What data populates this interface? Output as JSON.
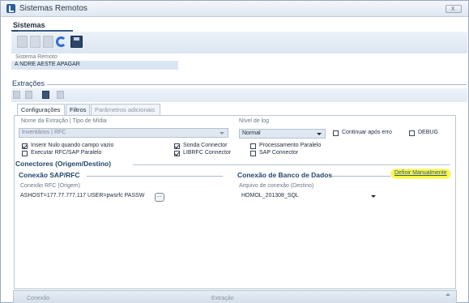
{
  "window": {
    "title": "Sistemas Remotos",
    "doc_tab": "Sistemas Remotos"
  },
  "toolbar": {
    "icons": [
      "new-icon",
      "edit-icon",
      "delete-icon",
      "refresh-icon",
      "save-icon"
    ]
  },
  "sistema": {
    "label": "Sistema Remoto",
    "value": "A NDRE AESTE APAGAR"
  },
  "extracoes": {
    "title": "Extrações",
    "toolbar_icons": [
      "add-icon",
      "edit-icon",
      "save-icon",
      "delete-icon"
    ]
  },
  "tabs": [
    {
      "label": "Configurações",
      "state": "active"
    },
    {
      "label": "Filtros",
      "state": "normal"
    },
    {
      "label": "Parâmetros adicionais",
      "state": "disabled"
    }
  ],
  "config": {
    "nome_label": "Nome da Extração | Tipo de Mídia",
    "nome_value": "Inventários | RFC",
    "nivel_label": "Nível de log",
    "nivel_value": "Normal",
    "continuar_label": "Continuar após erro",
    "continuar_checked": false,
    "debug_label": "DEBUG",
    "debug_checked": false,
    "checkboxes": [
      {
        "label": "Inserir Nulo quando campo vazio",
        "checked": true
      },
      {
        "label": "Executar RFC/SAP Paralelo",
        "checked": false
      },
      {
        "label": "Sonda Connector",
        "checked": true
      },
      {
        "label": "LIBRFC Connector",
        "checked": true
      },
      {
        "label": "Processamento Paralelo",
        "checked": false
      },
      {
        "label": "SAP Connector",
        "checked": false
      }
    ]
  },
  "conectores": {
    "title": "Conectores (Origem/Destino)",
    "sap_title": "Conexão SAP/RFC",
    "db_title": "Conexão de Banco de Dados",
    "definir_link": "Definir Manualmente",
    "rfc_label": "Conexão RFC (Origem)",
    "rfc_value": "ASHOST=177.77.777.117 USER=pwsrfc PASSW",
    "arquivo_label": "Arquivo de conexão (Destino)",
    "arquivo_value": "HOMOL_201308_SQL",
    "ellipsis": "..."
  },
  "bottom": {
    "col1": "Conexão",
    "col2": "Extração"
  },
  "colors": {
    "accent": "#24466e",
    "highlight": "#fbf83c",
    "link": "#27569a"
  }
}
